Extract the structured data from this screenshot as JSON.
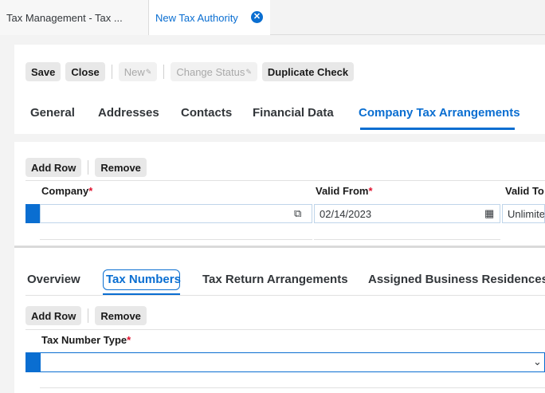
{
  "tabs": [
    {
      "label": "Tax Management - Tax ..."
    },
    {
      "label": "New Tax Authority"
    }
  ],
  "toolbar": {
    "save": "Save",
    "close": "Close",
    "new": "New",
    "change_status": "Change Status",
    "duplicate_check": "Duplicate Check"
  },
  "main_tabs": [
    "General",
    "Addresses",
    "Contacts",
    "Financial Data",
    "Company Tax Arrangements"
  ],
  "arrangements": {
    "add_row": "Add Row",
    "remove": "Remove",
    "columns": {
      "company": "Company",
      "valid_from": "Valid From",
      "valid_to": "Valid To"
    },
    "row": {
      "company": "",
      "valid_from": "02/14/2023",
      "valid_to": "Unlimited"
    }
  },
  "sub_tabs": [
    "Overview",
    "Tax Numbers",
    "Tax Return Arrangements",
    "Assigned Business Residences"
  ],
  "tax_numbers": {
    "add_row": "Add Row",
    "remove": "Remove",
    "columns": {
      "tax_number_type": "Tax Number Type"
    },
    "row": {
      "tax_number_type": ""
    }
  },
  "required_marker": "*",
  "icons": {
    "close": "close-circle-icon",
    "value_help": "value-help-icon",
    "calendar": "calendar-icon",
    "dropdown": "chevron-down-icon",
    "edit": "pencil-icon"
  },
  "colors": {
    "accent": "#0a6ed1",
    "required": "#e0112d"
  }
}
